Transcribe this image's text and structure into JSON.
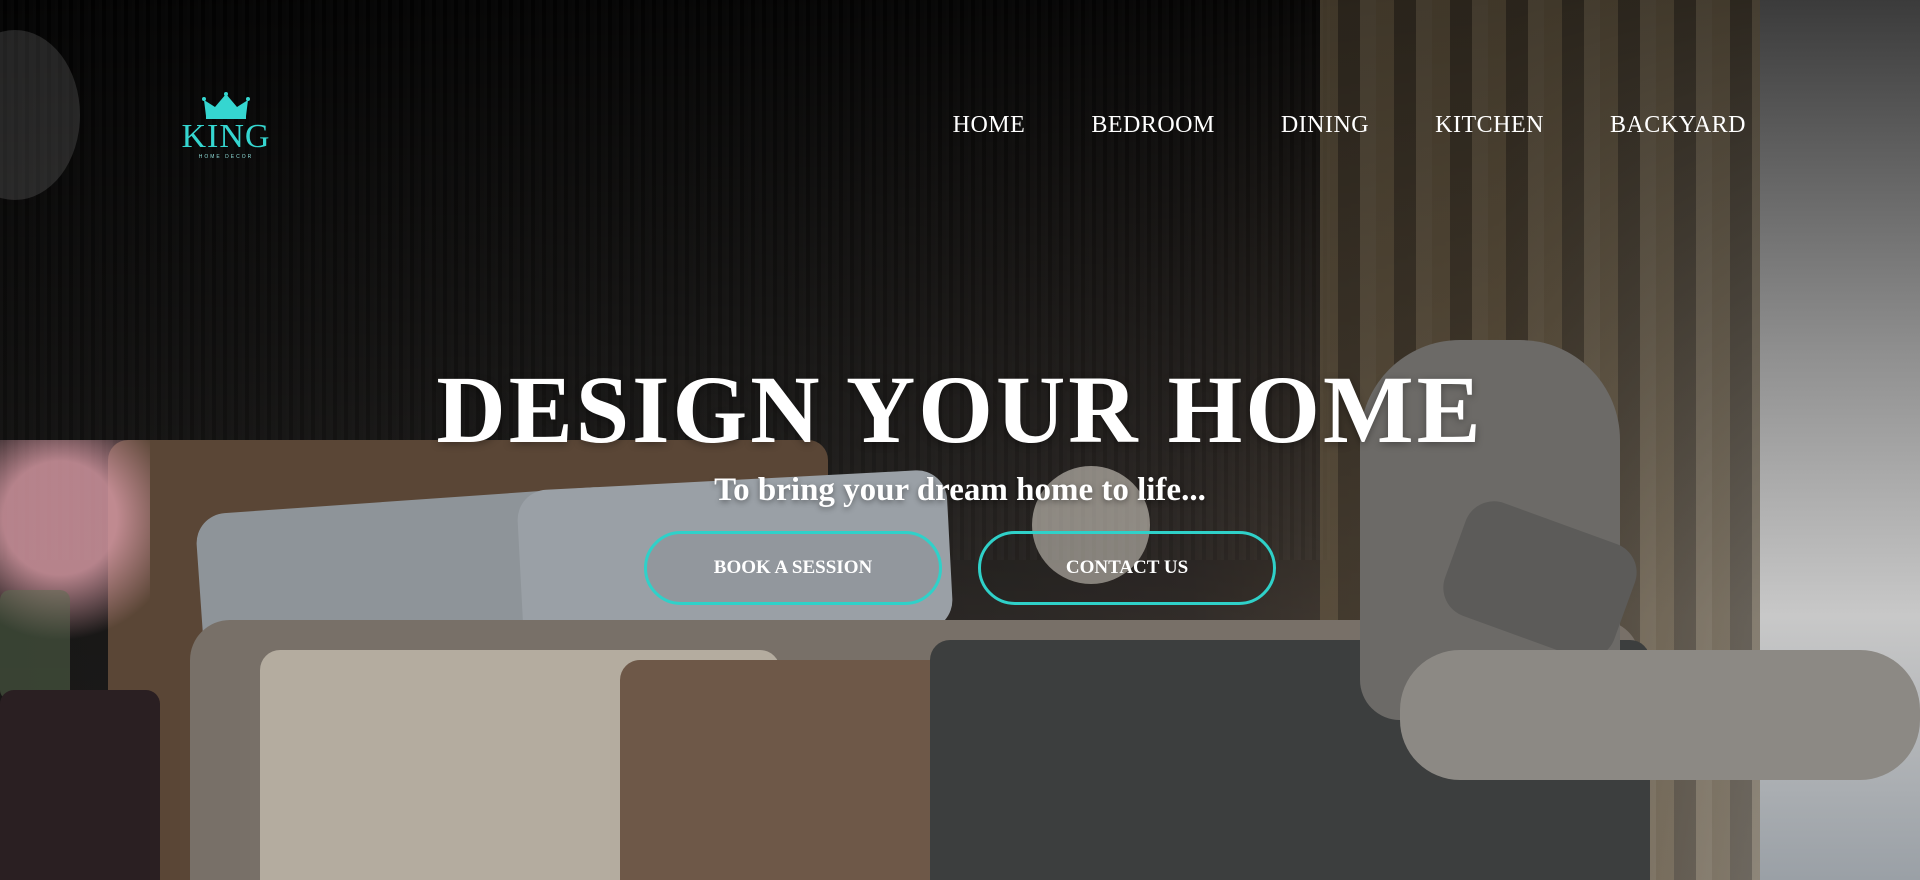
{
  "logo": {
    "brand": "KING",
    "tagline": "HOME DECOR",
    "icon": "crown-icon",
    "color": "#35d6d0"
  },
  "nav": {
    "items": [
      {
        "label": "HOME"
      },
      {
        "label": "BEDROOM"
      },
      {
        "label": "DINING"
      },
      {
        "label": "KITCHEN"
      },
      {
        "label": "BACKYARD"
      }
    ]
  },
  "hero": {
    "headline": "DESIGN YOUR HOME",
    "subline": "To bring your dream home to life...",
    "primary_button": "BOOK A SESSION",
    "secondary_button": "CONTACT US",
    "button_border_color": "#2fd1c9"
  }
}
